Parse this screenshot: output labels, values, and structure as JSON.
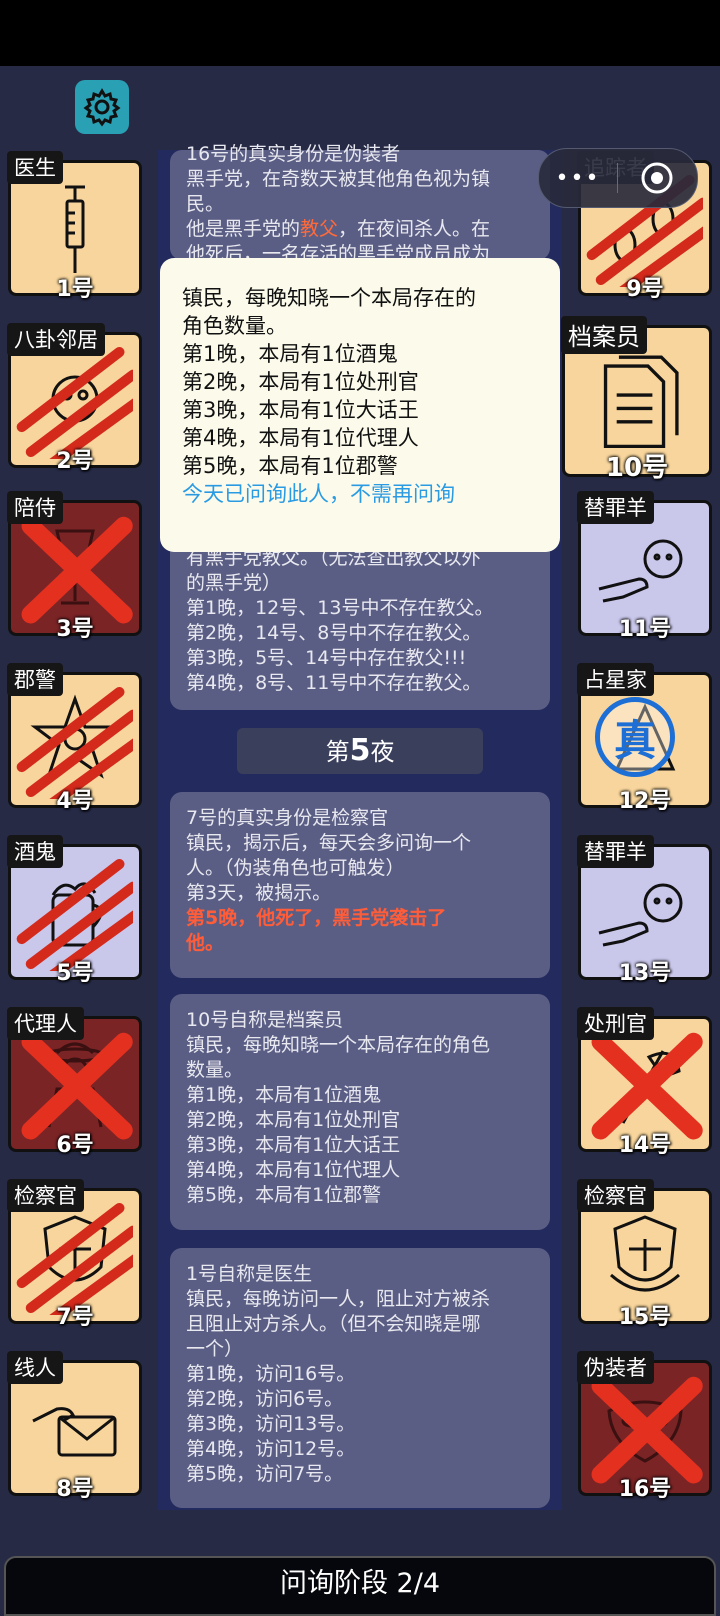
{
  "header": {
    "settings_icon": "gear-icon",
    "menu_more": "•••",
    "close_icon": "target-close-icon"
  },
  "left_column": [
    {
      "role": "医生",
      "num": "1号",
      "icon": "syringe-icon",
      "state": "normal"
    },
    {
      "role": "八卦邻居",
      "num": "2号",
      "icon": "neighbor-icon",
      "state": "clawed"
    },
    {
      "role": "陪侍",
      "num": "3号",
      "icon": "wineglass-icon",
      "state": "crossed"
    },
    {
      "role": "郡警",
      "num": "4号",
      "icon": "sheriff-star-icon",
      "state": "clawed"
    },
    {
      "role": "酒鬼",
      "num": "5号",
      "icon": "drunk-icon",
      "state": "clawed"
    },
    {
      "role": "代理人",
      "num": "6号",
      "icon": "agent-icon",
      "state": "crossed"
    },
    {
      "role": "检察官",
      "num": "7号",
      "icon": "prosecutor-icon",
      "state": "clawed"
    },
    {
      "role": "线人",
      "num": "8号",
      "icon": "envelope-hand-icon",
      "state": "normal"
    }
  ],
  "right_column": [
    {
      "role": "追踪者",
      "num": "9号",
      "icon": "tracker-icon",
      "state": "clawed"
    },
    {
      "role": "档案员",
      "num": "10号",
      "icon": "documents-icon",
      "state": "normal"
    },
    {
      "role": "替罪羊",
      "num": "11号",
      "icon": "sheep-pointing-icon",
      "state": "normal"
    },
    {
      "role": "占星家",
      "num": "12号",
      "icon": "astrologer-icon",
      "state": "true-stamp"
    },
    {
      "role": "替罪羊",
      "num": "13号",
      "icon": "sheep-pointing-icon",
      "state": "normal"
    },
    {
      "role": "处刑官",
      "num": "14号",
      "icon": "executioner-axe-icon",
      "state": "crossed"
    },
    {
      "role": "检察官",
      "num": "15号",
      "icon": "prosecutor-icon",
      "state": "normal"
    },
    {
      "role": "伪装者",
      "num": "16号",
      "icon": "mask-icon",
      "state": "crossed"
    }
  ],
  "stamp_text": "真",
  "top_card": {
    "line0": "16号的真实身份是伪装者",
    "line1": "黑手党，在奇数天被其他角色视为镇",
    "line2": "民。",
    "line3a": "他是黑手党的",
    "line3b": "教父",
    "line3c": "，在夜间杀人。在",
    "line4": "他死后，一名存活的黑手党成员成为"
  },
  "popup": {
    "line1": "镇民，每晚知晓一个本局存在的",
    "line2": "角色数量。",
    "line3": "第1晚，本局有1位酒鬼",
    "line4": "第2晚，本局有1位处刑官",
    "line5": "第3晚，本局有1位大话王",
    "line6": "第4晚，本局有1位代理人",
    "line7": "第5晚，本局有1位郡警",
    "notice": "今天已问询此人，不需再问询"
  },
  "card_partial": {
    "line1": "有黑手党教父。（无法查出教父以外",
    "line2": "的黑手党）",
    "line3": "第1晚，12号、13号中不存在教父。",
    "line4": "第2晚，14号、8号中不存在教父。",
    "line5": "第3晚，5号、14号中存在教父!!!",
    "line6": "第4晚，8号、11号中不存在教父。"
  },
  "night": {
    "prefix": "第",
    "number": "5",
    "suffix": "夜"
  },
  "card_7": {
    "line1": "7号的真实身份是检察官",
    "line2": "镇民，揭示后，每天会多问询一个",
    "line3": "人。（伪装角色也可触发）",
    "line4": "第3天，被揭示。",
    "line5": "第5晚，他死了，黑手党袭击了",
    "line6": "他。"
  },
  "card_10": {
    "line1": "10号自称是档案员",
    "line2": "镇民，每晚知晓一个本局存在的角色",
    "line3": "数量。",
    "line4": "第1晚，本局有1位酒鬼",
    "line5": "第2晚，本局有1位处刑官",
    "line6": "第3晚，本局有1位大话王",
    "line7": "第4晚，本局有1位代理人",
    "line8": "第5晚，本局有1位郡警"
  },
  "card_1": {
    "line1": "1号自称是医生",
    "line2": "镇民，每晚访问一人，阻止对方被杀",
    "line3": "且阻止对方杀人。（但不会知晓是哪",
    "line4": "一个）",
    "line5": "第1晚，访问16号。",
    "line6": "第2晚，访问6号。",
    "line7": "第3晚，访问13号。",
    "line8": "第4晚，访问12号。",
    "line9": "第5晚，访问7号。"
  },
  "footer": {
    "phase": "问询阶段 2/4"
  },
  "colors": {
    "tile_normal": "#f7d59c",
    "tile_lavender": "#c9c7ea",
    "tile_dead": "#7a2426",
    "claw_red": "#d32a1c",
    "notice_blue": "#2a9be3"
  }
}
